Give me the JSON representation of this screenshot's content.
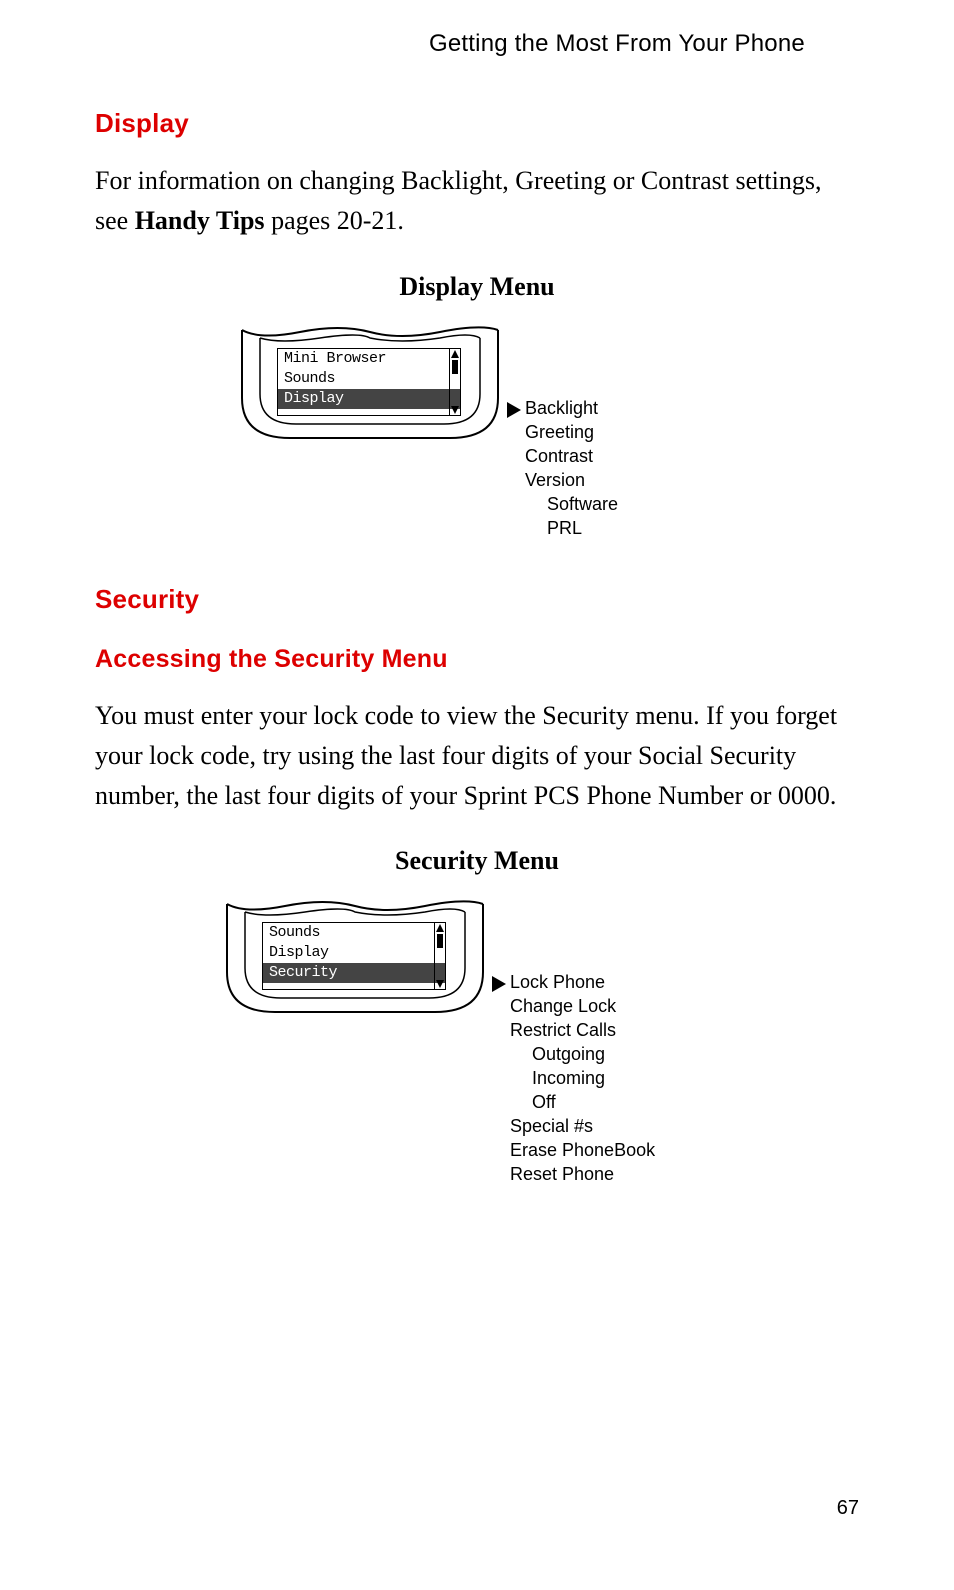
{
  "running_head": "Getting the Most From Your Phone",
  "display": {
    "heading": "Display",
    "para_1": "For information on changing Backlight, Greeting or Contrast settings, see ",
    "para_bold": "Handy Tips",
    "para_2": " pages 20-21.",
    "fig_title": "Display Menu",
    "lcd": {
      "row1": "Mini Browser",
      "row2": "Sounds",
      "row3": "Display"
    },
    "callout": {
      "l1": "Backlight",
      "l2": "Greeting",
      "l3": "Contrast",
      "l4": "Version",
      "l5": "Software",
      "l6": "PRL"
    }
  },
  "security": {
    "heading": "Security",
    "sub": "Accessing the Security Menu",
    "para": "You must enter your lock code to view the Security menu. If you forget your lock code, try using the last four digits of your Social Security number, the last four digits of your Sprint PCS Phone Number or 0000.",
    "fig_title": "Security Menu",
    "lcd": {
      "row1": "Sounds",
      "row2": "Display",
      "row3": "Security"
    },
    "callout": {
      "l1": "Lock Phone",
      "l2": "Change Lock",
      "l3": "Restrict Calls",
      "l4": "Outgoing",
      "l5": "Incoming",
      "l6": "Off",
      "l7": "Special #s",
      "l8": "Erase PhoneBook",
      "l9": "Reset Phone"
    }
  },
  "page_num": "67"
}
